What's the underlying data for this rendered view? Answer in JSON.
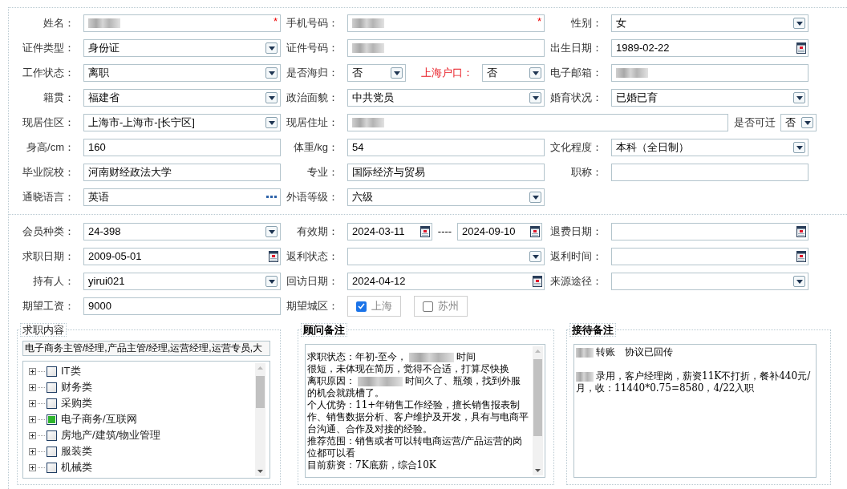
{
  "personal": [
    [
      {
        "kind": "field",
        "label": "姓名：",
        "field": {
          "kind": "text",
          "redacted": true,
          "required_mark": "*"
        }
      },
      {
        "kind": "field",
        "label": "手机号码：",
        "field": {
          "kind": "text",
          "redacted": true,
          "required_mark": "*"
        }
      },
      {
        "kind": "field",
        "label": "性别：",
        "field": {
          "kind": "select",
          "value": "女"
        }
      }
    ],
    [
      {
        "kind": "field",
        "label": "证件类型：",
        "field": {
          "kind": "select",
          "value": "身份证"
        }
      },
      {
        "kind": "field",
        "label": "证件号码：",
        "field": {
          "kind": "text",
          "redacted": true
        }
      },
      {
        "kind": "field",
        "label": "出生日期：",
        "field": {
          "kind": "date",
          "value": "1989-02-22"
        }
      }
    ],
    [
      {
        "kind": "field",
        "label": "工作状态：",
        "field": {
          "kind": "select",
          "value": "离职"
        }
      },
      {
        "kind": "pair",
        "items": [
          {
            "label": "是否海归：",
            "highlighted": false,
            "field": {
              "kind": "select",
              "value": "否"
            }
          },
          {
            "label": "上海户口：",
            "highlighted": true,
            "field": {
              "kind": "select",
              "value": "否"
            }
          }
        ]
      },
      {
        "kind": "field",
        "label": "电子邮箱：",
        "field": {
          "kind": "text",
          "redacted": true
        }
      }
    ],
    [
      {
        "kind": "field",
        "label": "籍贯：",
        "field": {
          "kind": "select",
          "value": "福建省"
        }
      },
      {
        "kind": "field",
        "label": "政治面貌：",
        "field": {
          "kind": "select",
          "value": "中共党员"
        }
      },
      {
        "kind": "field",
        "label": "婚育状况：",
        "field": {
          "kind": "select",
          "value": "已婚已育"
        }
      }
    ],
    [
      {
        "kind": "field",
        "label": "现居住区：",
        "field": {
          "kind": "select",
          "value": "上海市-上海市-[长宁区]"
        }
      },
      {
        "kind": "address",
        "label": "现居住址：",
        "field": {
          "kind": "text",
          "redacted": true
        },
        "extra": {
          "label": "是否可迁",
          "field": {
            "kind": "select",
            "value": "否"
          }
        }
      }
    ],
    [
      {
        "kind": "field",
        "label": "身高/cm：",
        "field": {
          "kind": "text",
          "value": "160"
        }
      },
      {
        "kind": "field",
        "label": "体重/kg：",
        "field": {
          "kind": "text",
          "value": "54"
        }
      },
      {
        "kind": "field",
        "label": "文化程度：",
        "field": {
          "kind": "select",
          "value": "本科（全日制）"
        }
      }
    ],
    [
      {
        "kind": "field",
        "label": "毕业院校：",
        "field": {
          "kind": "text",
          "value": "河南财经政法大学"
        }
      },
      {
        "kind": "field",
        "label": "专业：",
        "field": {
          "kind": "text",
          "value": "国际经济与贸易"
        }
      },
      {
        "kind": "field",
        "label": "职称：",
        "field": {
          "kind": "text"
        }
      }
    ],
    [
      {
        "kind": "field",
        "label": "通晓语言：",
        "field": {
          "kind": "lookup",
          "value": "英语"
        }
      },
      {
        "kind": "field",
        "label": "外语等级：",
        "field": {
          "kind": "select",
          "value": "六级"
        }
      }
    ]
  ],
  "membership": [
    [
      {
        "kind": "field",
        "label": "会员种类：",
        "field": {
          "kind": "select",
          "value": "24-398"
        }
      },
      {
        "kind": "range",
        "label": "有效期：",
        "from": {
          "kind": "date",
          "value": "2024-03-11"
        },
        "separator": "----",
        "to": {
          "kind": "date",
          "value": "2024-09-10"
        }
      },
      {
        "kind": "field",
        "label": "退费日期：",
        "field": {
          "kind": "date"
        }
      }
    ],
    [
      {
        "kind": "field",
        "label": "求职日期：",
        "field": {
          "kind": "date",
          "value": "2009-05-01"
        }
      },
      {
        "kind": "field",
        "label": "返利状态：",
        "field": {
          "kind": "select"
        }
      },
      {
        "kind": "field",
        "label": "返利时间：",
        "field": {
          "kind": "date"
        }
      }
    ],
    [
      {
        "kind": "field",
        "label": "持有人：",
        "field": {
          "kind": "select",
          "value": "yirui021"
        }
      },
      {
        "kind": "field",
        "label": "回访日期：",
        "field": {
          "kind": "date",
          "value": "2024-04-12"
        }
      },
      {
        "kind": "field",
        "label": "来源途径：",
        "field": {
          "kind": "select"
        }
      }
    ],
    [
      {
        "kind": "field",
        "label": "期望工资：",
        "field": {
          "kind": "text",
          "value": "9000"
        }
      },
      {
        "kind": "choices",
        "label": "期望城区：",
        "options": [
          {
            "label": "上海",
            "checked": true
          },
          {
            "label": "苏州",
            "checked": false
          }
        ]
      }
    ]
  ],
  "panels": [
    {
      "kind": "tree",
      "title": "求职内容",
      "summary": "电子商务主管/经理,产品主管/经理,运营经理,运营专员,大",
      "items": [
        {
          "label": "IT类",
          "checked": false
        },
        {
          "label": "财务类",
          "checked": false
        },
        {
          "label": "采购类",
          "checked": false
        },
        {
          "label": "电子商务/互联网",
          "checked": true
        },
        {
          "label": "房地产/建筑/物业管理",
          "checked": false
        },
        {
          "label": "服装类",
          "checked": false
        },
        {
          "label": "机械类",
          "checked": false
        }
      ]
    },
    {
      "kind": "memo",
      "title": "顾问备注",
      "lines": [
        [
          {
            "kind": "text",
            "text": "求职状态：年初-至今，"
          },
          {
            "kind": "redacted"
          },
          {
            "kind": "text",
            "text": "时间"
          }
        ],
        [
          {
            "kind": "text",
            "text": "很短，未体现在简历，觉得不合适，打算尽快换"
          }
        ],
        [
          {
            "kind": "text",
            "text": "离职原因："
          },
          {
            "kind": "redacted"
          },
          {
            "kind": "text",
            "text": "时间久了、瓶颈，找到外服"
          }
        ],
        [
          {
            "kind": "text",
            "text": "的机会就跳槽了。"
          }
        ],
        [
          {
            "kind": "text",
            "text": "个人优势：11+年销售工作经验，擅长销售报表制"
          }
        ],
        [
          {
            "kind": "text",
            "text": "作、销售数据分析、客户维护及开发，具有与电商平"
          }
        ],
        [
          {
            "kind": "text",
            "text": "台沟通、合作及对接的经验。"
          }
        ],
        [
          {
            "kind": "text",
            "text": "推荐范围：销售或者可以转电商运营/产品运营的岗"
          }
        ],
        [
          {
            "kind": "text",
            "text": "位都可以看"
          }
        ],
        [
          {
            "kind": "text",
            "text": "目前薪资：7K底薪，综合10K"
          }
        ]
      ]
    },
    {
      "kind": "memo",
      "title": "接待备注",
      "lines": [
        [
          {
            "kind": "redacted"
          },
          {
            "kind": "text",
            "text": "转账　协议已回传"
          }
        ],
        [
          {
            "kind": "break"
          }
        ],
        [
          {
            "kind": "redacted"
          },
          {
            "kind": "text",
            "text": "录用，客户经理岗，薪资11K不打折，餐补440元/"
          }
        ],
        [
          {
            "kind": "text",
            "text": "月，收：11440*0.75=8580，4/22入职"
          }
        ]
      ]
    }
  ]
}
